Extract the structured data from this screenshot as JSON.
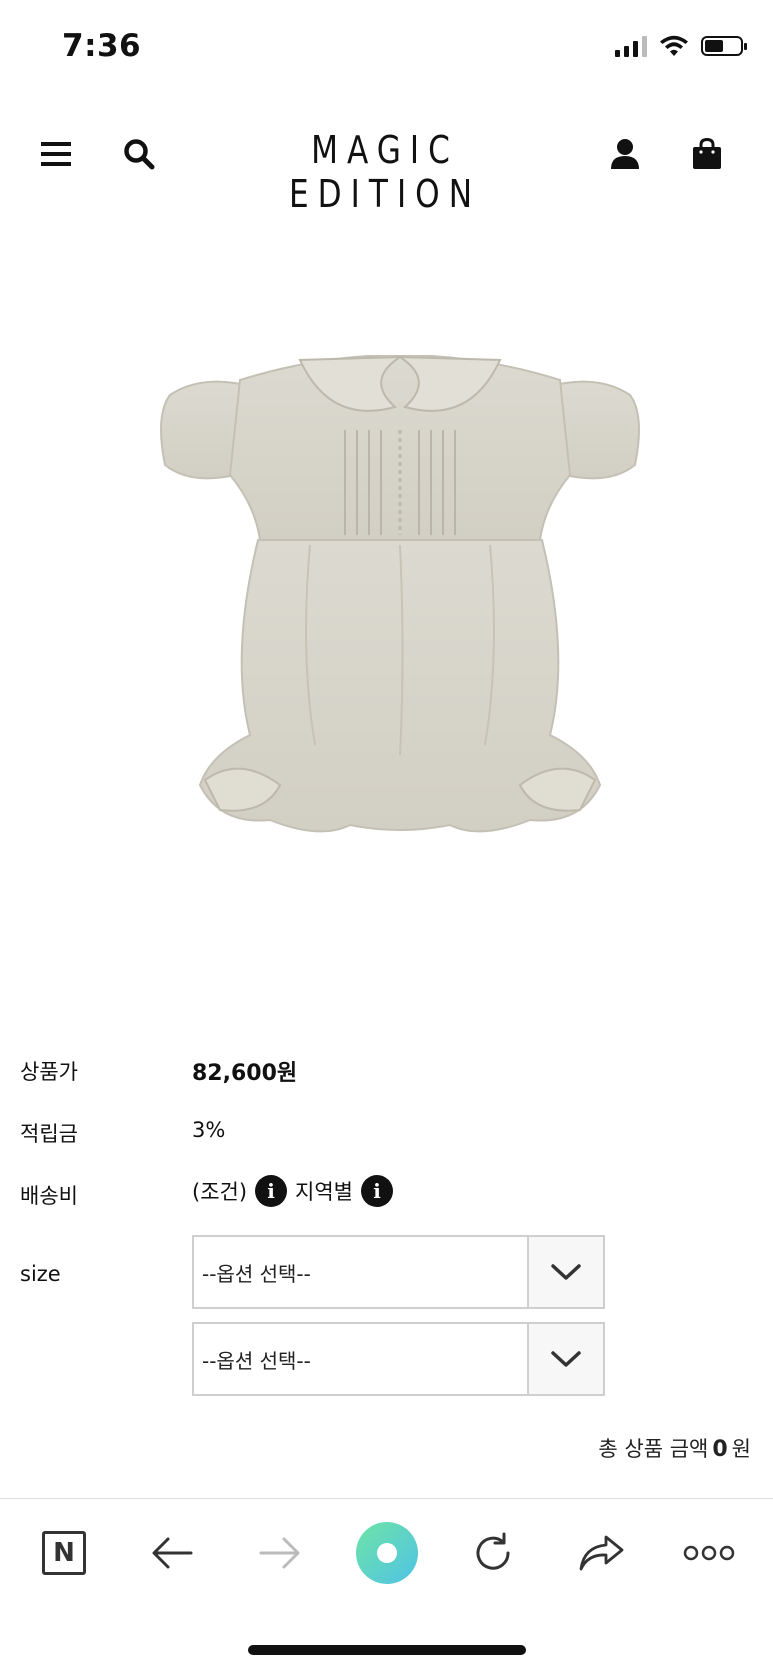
{
  "status": {
    "time": "7:36"
  },
  "header": {
    "brand": "MAGIC EDITION",
    "icons": [
      "menu-icon",
      "search-icon",
      "user-icon",
      "shopping-bag-icon"
    ]
  },
  "product": {
    "price_label": "상품가",
    "price_value": "82,600원",
    "points_label": "적립금",
    "points_value": "3%",
    "shipping_label": "배송비",
    "shipping_condition": "(조건)",
    "shipping_region": "지역별",
    "info_glyph": "i",
    "size_label": "size",
    "select_1": "--옵션 선택--",
    "select_2": "--옵션 선택--"
  },
  "total": {
    "prefix": "총 상품 금액",
    "amount": "0",
    "unit": "원"
  },
  "browser_bar": {
    "icons": [
      "naver-icon",
      "back-arrow-icon",
      "forward-arrow-icon",
      "green-circle-icon",
      "reload-icon",
      "share-icon",
      "more-icon"
    ],
    "naver_letter": "N"
  },
  "colors": {
    "accent_gradient_start": "#6fe3a6",
    "accent_gradient_end": "#4fc3e6",
    "garment": "#d8d5ca"
  }
}
